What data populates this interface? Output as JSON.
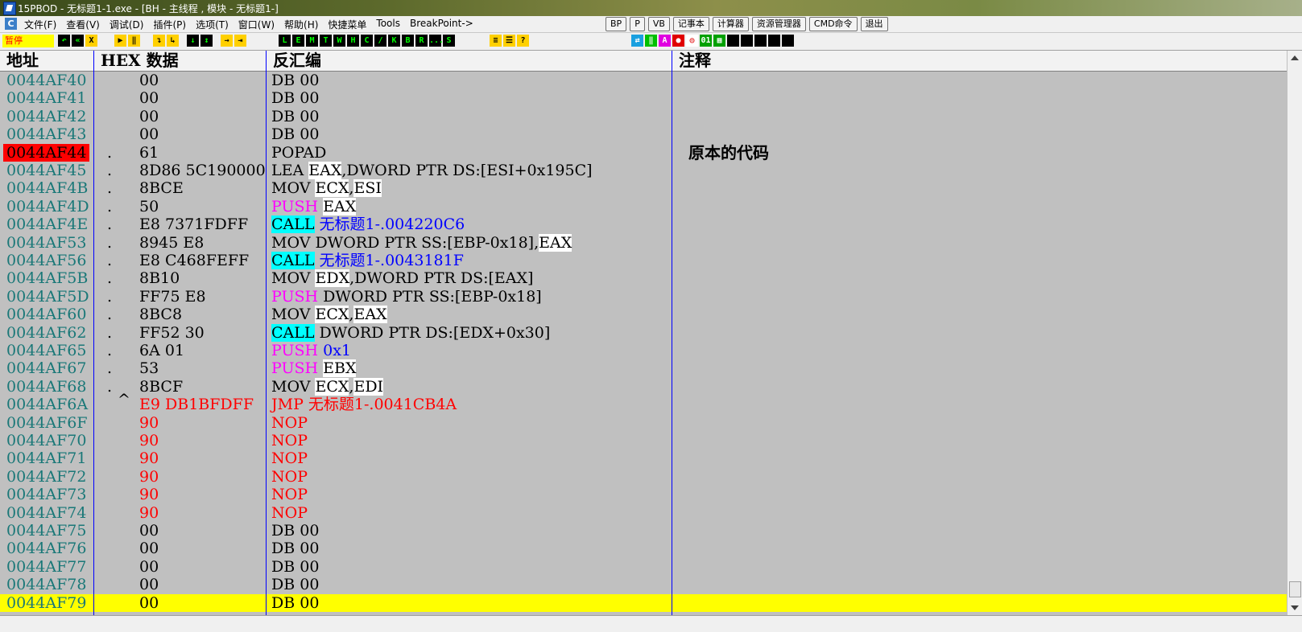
{
  "window": {
    "title": "15PBOD  - 无标题1-1.exe - [BH - 主线程 , 模块 - 无标题1-]"
  },
  "menu": {
    "items": [
      "文件(F)",
      "查看(V)",
      "调试(D)",
      "插件(P)",
      "选项(T)",
      "窗口(W)",
      "帮助(H)",
      "快捷菜单",
      "Tools",
      "BreakPoint->"
    ],
    "buttons": [
      "BP",
      "P",
      "VB",
      "记事本",
      "计算器",
      "资源管理器",
      "CMD命令",
      "退出"
    ]
  },
  "toolbar": {
    "status": "暂停",
    "run_buttons": [
      "↶",
      "◀◀",
      "X",
      "▶",
      "II",
      "↴",
      "↳",
      "↓",
      "↑",
      "→"
    ],
    "letter_buttons": [
      "L",
      "E",
      "M",
      "T",
      "W",
      "H",
      "C",
      "/",
      "K",
      "B",
      "R",
      "...",
      "S"
    ],
    "colors": {
      "status_bg": "#ffff00",
      "status_text": "#ff0000"
    }
  },
  "columns": {
    "address": "地址",
    "hex": "HEX 数据",
    "disasm": "反汇编",
    "comment": "注释"
  },
  "rows": [
    {
      "addr": "0044AF40",
      "mark": "",
      "hex": "00",
      "hex_red": false,
      "tokens": [
        {
          "t": "DB 00",
          "s": ""
        }
      ],
      "comment": ""
    },
    {
      "addr": "0044AF41",
      "mark": "",
      "hex": "00",
      "hex_red": false,
      "tokens": [
        {
          "t": "DB 00",
          "s": ""
        }
      ],
      "comment": ""
    },
    {
      "addr": "0044AF42",
      "mark": "",
      "hex": "00",
      "hex_red": false,
      "tokens": [
        {
          "t": "DB 00",
          "s": ""
        }
      ],
      "comment": ""
    },
    {
      "addr": "0044AF43",
      "mark": "",
      "hex": "00",
      "hex_red": false,
      "tokens": [
        {
          "t": "DB 00",
          "s": ""
        }
      ],
      "comment": ""
    },
    {
      "addr": "0044AF44",
      "mark": ".",
      "hex": "61",
      "hex_red": false,
      "highlight": true,
      "tokens": [
        {
          "t": "POPAD",
          "s": ""
        }
      ],
      "comment": "原本的代码"
    },
    {
      "addr": "0044AF45",
      "mark": ".",
      "hex": "8D86 5C190000",
      "hex_red": false,
      "tokens": [
        {
          "t": "LEA ",
          "s": ""
        },
        {
          "t": "EAX",
          "s": "wh"
        },
        {
          "t": ",DWORD PTR DS:[ESI+0x195C]",
          "s": ""
        }
      ],
      "comment": ""
    },
    {
      "addr": "0044AF4B",
      "mark": ".",
      "hex": "8BCE",
      "hex_red": false,
      "tokens": [
        {
          "t": "MOV ",
          "s": ""
        },
        {
          "t": "ECX",
          "s": "wh"
        },
        {
          "t": ",",
          "s": ""
        },
        {
          "t": "ESI",
          "s": "wh"
        }
      ],
      "comment": ""
    },
    {
      "addr": "0044AF4D",
      "mark": ".",
      "hex": "50",
      "hex_red": false,
      "tokens": [
        {
          "t": "PUSH",
          "s": "mag"
        },
        {
          "t": " ",
          "s": ""
        },
        {
          "t": "EAX",
          "s": "wh"
        }
      ],
      "comment": ""
    },
    {
      "addr": "0044AF4E",
      "mark": ".",
      "hex": "E8 7371FDFF",
      "hex_red": false,
      "tokens": [
        {
          "t": "CALL",
          "s": "cyan"
        },
        {
          "t": " 无标题1-.004220C6",
          "s": "blue"
        }
      ],
      "comment": ""
    },
    {
      "addr": "0044AF53",
      "mark": ".",
      "hex": "8945 E8",
      "hex_red": false,
      "tokens": [
        {
          "t": "MOV DWORD PTR SS:[EBP-0x18],",
          "s": ""
        },
        {
          "t": "EAX",
          "s": "wh"
        }
      ],
      "comment": ""
    },
    {
      "addr": "0044AF56",
      "mark": ".",
      "hex": "E8 C468FEFF",
      "hex_red": false,
      "tokens": [
        {
          "t": "CALL",
          "s": "cyan"
        },
        {
          "t": " 无标题1-.0043181F",
          "s": "blue"
        }
      ],
      "comment": ""
    },
    {
      "addr": "0044AF5B",
      "mark": ".",
      "hex": "8B10",
      "hex_red": false,
      "tokens": [
        {
          "t": "MOV ",
          "s": ""
        },
        {
          "t": "EDX",
          "s": "wh"
        },
        {
          "t": ",DWORD PTR DS:[EAX]",
          "s": ""
        }
      ],
      "comment": ""
    },
    {
      "addr": "0044AF5D",
      "mark": ".",
      "hex": "FF75 E8",
      "hex_red": false,
      "tokens": [
        {
          "t": "PUSH",
          "s": "mag"
        },
        {
          "t": " DWORD PTR SS:[EBP-0x18]",
          "s": ""
        }
      ],
      "comment": ""
    },
    {
      "addr": "0044AF60",
      "mark": ".",
      "hex": "8BC8",
      "hex_red": false,
      "tokens": [
        {
          "t": "MOV ",
          "s": ""
        },
        {
          "t": "ECX",
          "s": "wh"
        },
        {
          "t": ",",
          "s": ""
        },
        {
          "t": "EAX",
          "s": "wh"
        }
      ],
      "comment": ""
    },
    {
      "addr": "0044AF62",
      "mark": ".",
      "hex": "FF52 30",
      "hex_red": false,
      "tokens": [
        {
          "t": "CALL",
          "s": "cyan"
        },
        {
          "t": " DWORD PTR DS:[EDX+0x30]",
          "s": ""
        }
      ],
      "comment": ""
    },
    {
      "addr": "0044AF65",
      "mark": ".",
      "hex": "6A 01",
      "hex_red": false,
      "tokens": [
        {
          "t": "PUSH",
          "s": "mag"
        },
        {
          "t": " 0x1",
          "s": "blue"
        }
      ],
      "comment": ""
    },
    {
      "addr": "0044AF67",
      "mark": ".",
      "hex": "53",
      "hex_red": false,
      "tokens": [
        {
          "t": "PUSH",
          "s": "mag"
        },
        {
          "t": " ",
          "s": ""
        },
        {
          "t": "EBX",
          "s": "wh"
        }
      ],
      "comment": ""
    },
    {
      "addr": "0044AF68",
      "mark": ".",
      "hex": "8BCF",
      "hex_red": false,
      "tokens": [
        {
          "t": "MOV ",
          "s": ""
        },
        {
          "t": "ECX",
          "s": "wh"
        },
        {
          "t": ",",
          "s": ""
        },
        {
          "t": "EDI",
          "s": "wh"
        }
      ],
      "comment": ""
    },
    {
      "addr": "0044AF6A",
      "mark": "^",
      "hex": "E9 DB1BFDFF",
      "hex_red": true,
      "tokens": [
        {
          "t": "JMP 无标题1-.0041CB4A",
          "s": "red"
        }
      ],
      "comment": ""
    },
    {
      "addr": "0044AF6F",
      "mark": "",
      "hex": "90",
      "hex_red": true,
      "tokens": [
        {
          "t": "NOP",
          "s": "red"
        }
      ],
      "comment": ""
    },
    {
      "addr": "0044AF70",
      "mark": "",
      "hex": "90",
      "hex_red": true,
      "tokens": [
        {
          "t": "NOP",
          "s": "red"
        }
      ],
      "comment": ""
    },
    {
      "addr": "0044AF71",
      "mark": "",
      "hex": "90",
      "hex_red": true,
      "tokens": [
        {
          "t": "NOP",
          "s": "red"
        }
      ],
      "comment": ""
    },
    {
      "addr": "0044AF72",
      "mark": "",
      "hex": "90",
      "hex_red": true,
      "tokens": [
        {
          "t": "NOP",
          "s": "red"
        }
      ],
      "comment": ""
    },
    {
      "addr": "0044AF73",
      "mark": "",
      "hex": "90",
      "hex_red": true,
      "tokens": [
        {
          "t": "NOP",
          "s": "red"
        }
      ],
      "comment": ""
    },
    {
      "addr": "0044AF74",
      "mark": "",
      "hex": "90",
      "hex_red": true,
      "tokens": [
        {
          "t": "NOP",
          "s": "red"
        }
      ],
      "comment": ""
    },
    {
      "addr": "0044AF75",
      "mark": "",
      "hex": "00",
      "hex_red": false,
      "tokens": [
        {
          "t": "DB 00",
          "s": ""
        }
      ],
      "comment": ""
    },
    {
      "addr": "0044AF76",
      "mark": "",
      "hex": "00",
      "hex_red": false,
      "tokens": [
        {
          "t": "DB 00",
          "s": ""
        }
      ],
      "comment": ""
    },
    {
      "addr": "0044AF77",
      "mark": "",
      "hex": "00",
      "hex_red": false,
      "tokens": [
        {
          "t": "DB 00",
          "s": ""
        }
      ],
      "comment": ""
    },
    {
      "addr": "0044AF78",
      "mark": "",
      "hex": "00",
      "hex_red": false,
      "tokens": [
        {
          "t": "DB 00",
          "s": ""
        }
      ],
      "comment": ""
    },
    {
      "addr": "0044AF79",
      "mark": "",
      "hex": "00",
      "hex_red": false,
      "selected": true,
      "tokens": [
        {
          "t": "DB 00",
          "s": ""
        }
      ],
      "comment": ""
    }
  ]
}
